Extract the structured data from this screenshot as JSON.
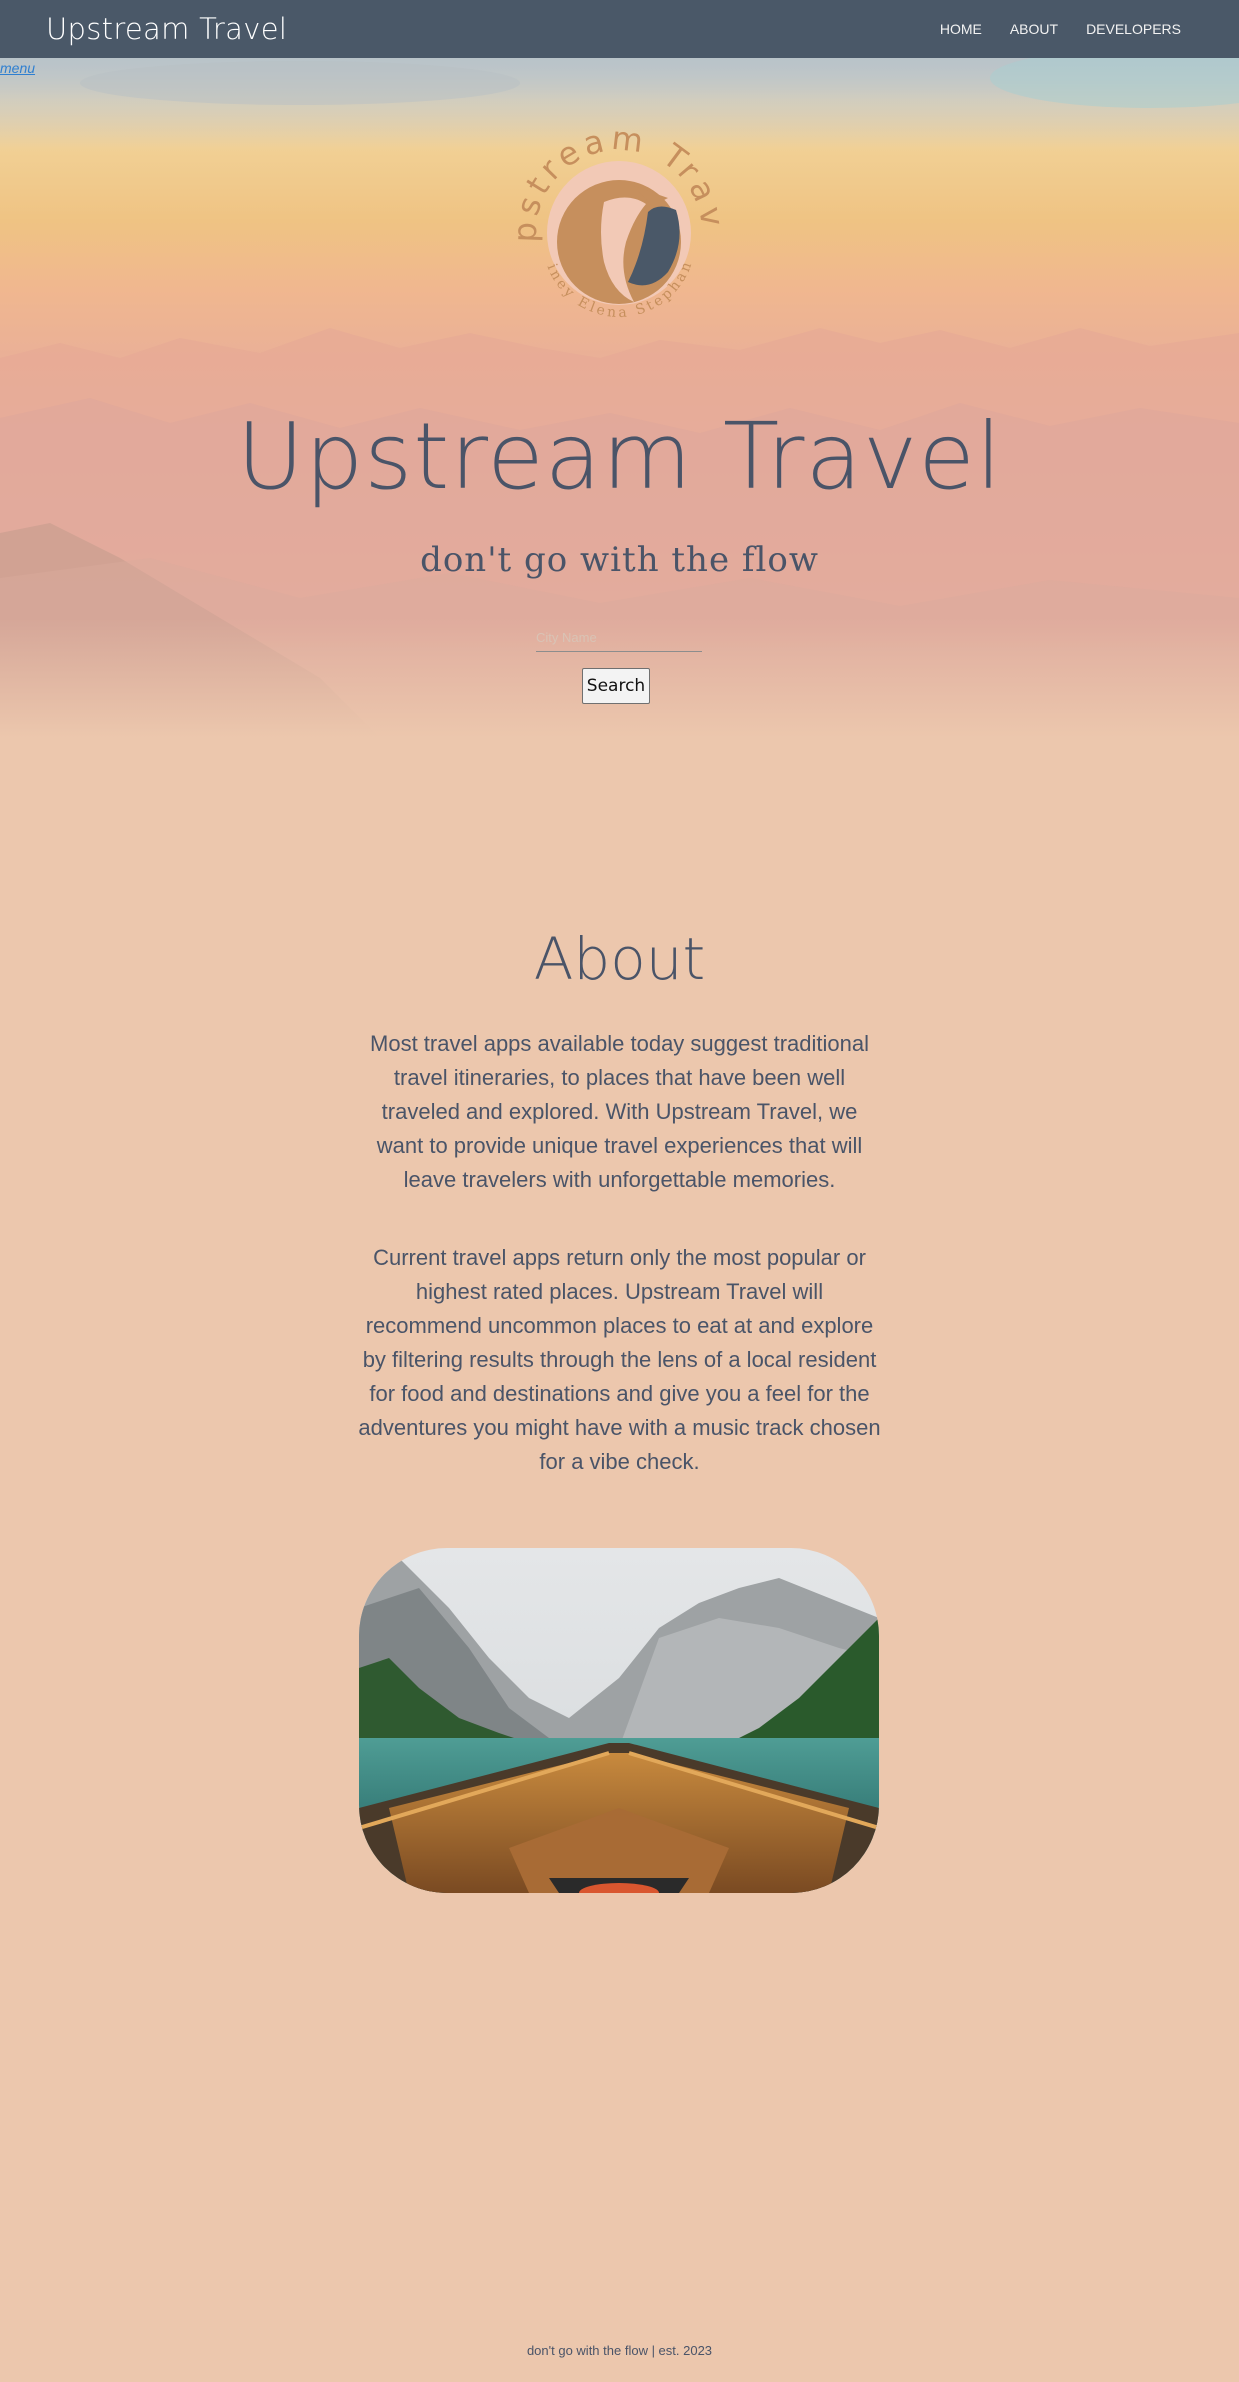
{
  "navbar": {
    "brand": "Upstream Travel",
    "links": [
      "HOME",
      "ABOUT",
      "DEVELOPERS"
    ]
  },
  "menu_label": "menu",
  "hero": {
    "logo": {
      "ring_text": "Upstream Travel",
      "inner_text": "Lainey Elena Stephanie"
    },
    "title": "Upstream Travel",
    "tagline": "don't go with the flow",
    "search": {
      "placeholder": "City Name",
      "value": "",
      "button_label": "Search"
    }
  },
  "about": {
    "title": "About",
    "paragraphs": [
      "Most travel apps available today suggest traditional travel itineraries, to places that have been well traveled and explored. With Upstream Travel, we want to provide unique travel experiences that will leave travelers with unforgettable memories.",
      "Current travel apps return only the most popular or highest rated places. Upstream Travel will recommend uncommon places to eat at and explore by filtering results through the lens of a local resident for food and destinations and give you a feel for the adventures you might have with a music track chosen for a vibe check."
    ]
  },
  "footer": "don't go with the flow | est. 2023",
  "colors": {
    "navbar": "#4a5868",
    "page_background": "#ecc7ad",
    "text": "#4a5468",
    "logo_tan": "#c68f5d",
    "menu_link": "#2f7fd0"
  }
}
